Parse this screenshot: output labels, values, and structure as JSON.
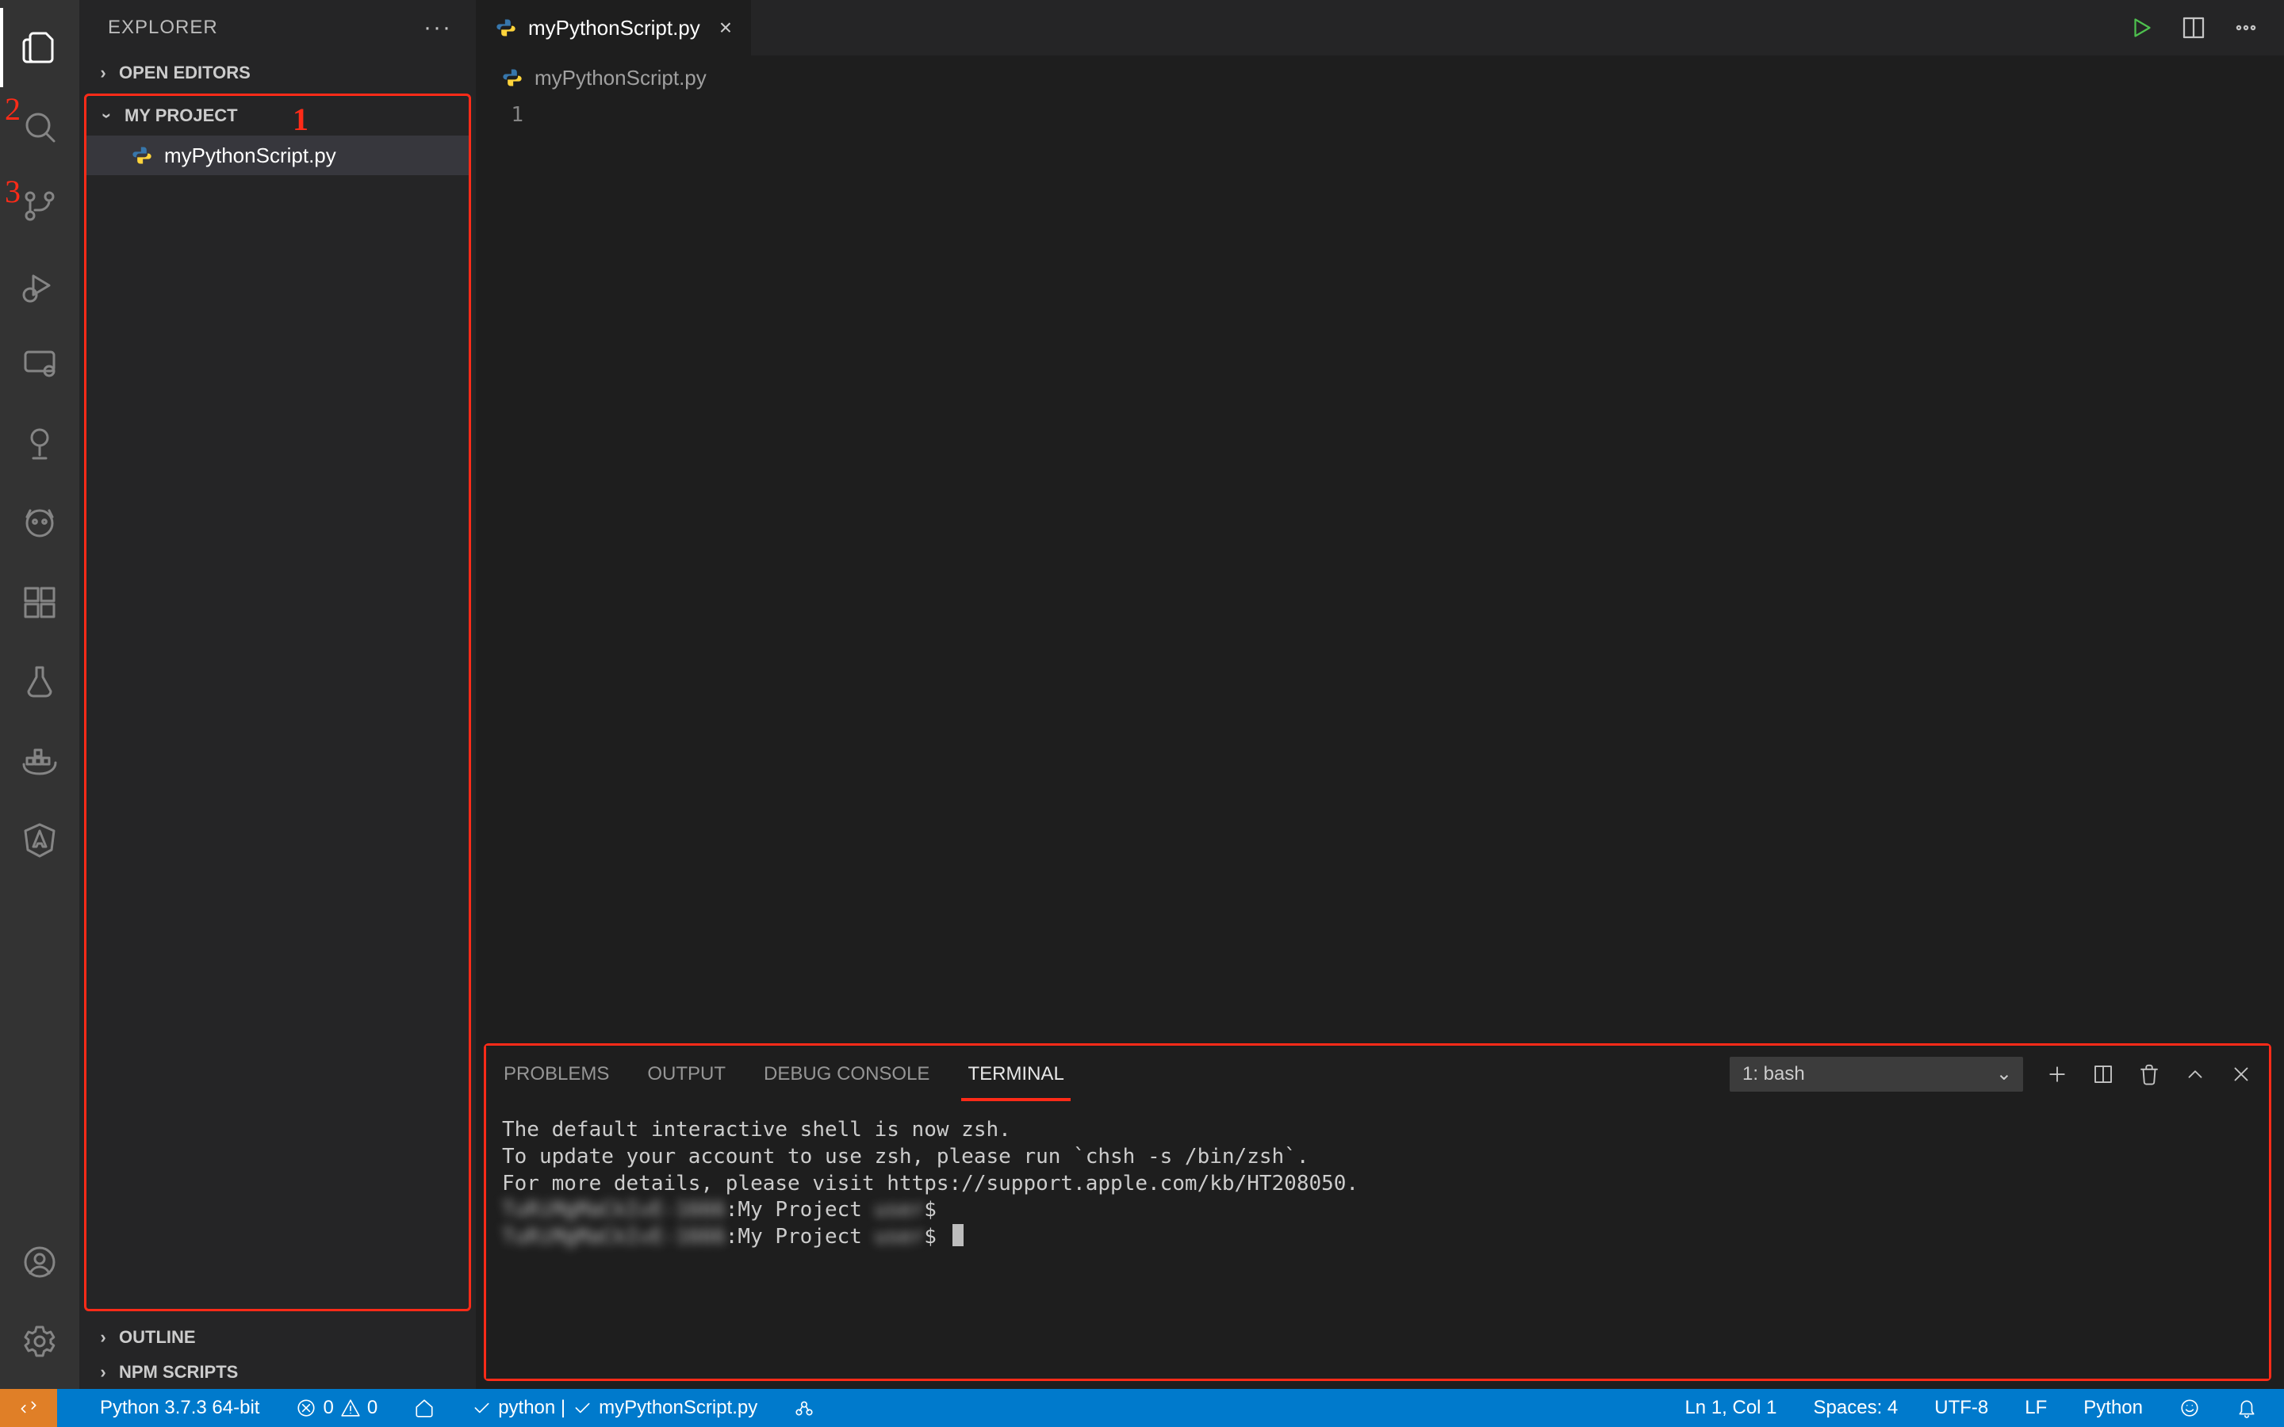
{
  "sidebar": {
    "title": "EXPLORER",
    "sections": {
      "open_editors": "OPEN EDITORS",
      "project": "MY PROJECT",
      "outline": "OUTLINE",
      "npm_scripts": "NPM SCRIPTS"
    },
    "files": [
      {
        "name": "myPythonScript.py"
      }
    ]
  },
  "tabs": {
    "active": {
      "label": "myPythonScript.py"
    }
  },
  "breadcrumb": {
    "file": "myPythonScript.py"
  },
  "editor": {
    "line_numbers": [
      "1"
    ]
  },
  "panel": {
    "tabs": {
      "problems": "PROBLEMS",
      "output": "OUTPUT",
      "debug_console": "DEBUG CONSOLE",
      "terminal": "TERMINAL"
    },
    "terminal_selector": "1: bash",
    "terminal_lines": [
      "The default interactive shell is now zsh.",
      "To update your account to use zsh, please run `chsh -s /bin/zsh`.",
      "For more details, please visit https://support.apple.com/kb/HT208050."
    ],
    "prompt_host_blur": "TuRiMgMaCkIvE-1666",
    "prompt_path": ":My Project ",
    "prompt_user_blur": "user",
    "prompt_symbol": "$ "
  },
  "statusbar": {
    "python": "Python 3.7.3 64-bit",
    "errors": "0",
    "warnings": "0",
    "lint": "python | ",
    "lint2": "myPythonScript.py",
    "ln_col": "Ln 1, Col 1",
    "spaces": "Spaces: 4",
    "encoding": "UTF-8",
    "eol": "LF",
    "language": "Python"
  },
  "annotations": {
    "one": "1",
    "two": "2",
    "three": "3"
  }
}
